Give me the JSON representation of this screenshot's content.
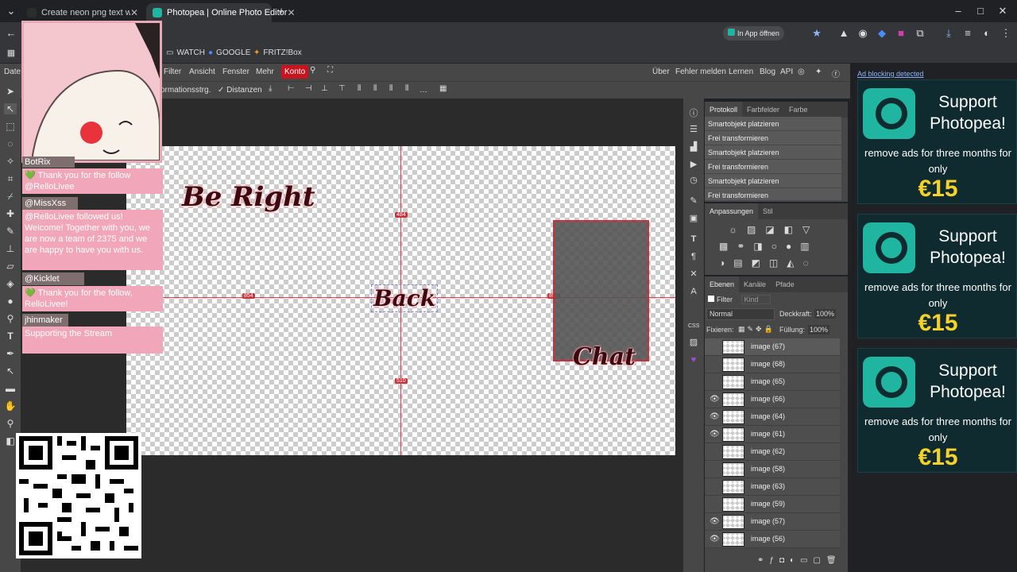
{
  "tabs": [
    {
      "title": "Create neon png text with a tra",
      "active": false
    },
    {
      "title": "Photopea | Online Photo Editor",
      "active": true
    }
  ],
  "address": {
    "open_in_app": "In App öffnen"
  },
  "bookmarks": [
    "WATCH",
    "GOOGLE",
    "FRITZ!Box"
  ],
  "menu": {
    "partial": "Date",
    "items": [
      "Filter",
      "Ansicht",
      "Fenster",
      "Mehr",
      "Konto"
    ],
    "right": [
      "Über",
      "Fehler melden",
      "Lernen",
      "Blog",
      "API"
    ]
  },
  "options": {
    "transform_label": "ormationsstrg.",
    "distances_label": "✓ Distanzen"
  },
  "history": {
    "tabs": [
      "Protokoll",
      "Farbfelder",
      "Farbe"
    ],
    "items": [
      "Smartobjekt platzieren",
      "Frei transformieren",
      "Smartobjekt platzieren",
      "Frei transformieren",
      "Smartobjekt platzieren",
      "Frei transformieren"
    ]
  },
  "adjust": {
    "tabs": [
      "Anpassungen",
      "Stil"
    ]
  },
  "layers": {
    "tabs": [
      "Ebenen",
      "Kanäle",
      "Pfade"
    ],
    "filter": "Filter",
    "kind": "Kind",
    "blend": "Normal",
    "opacity_label": "Deckkraft:",
    "opacity": "100%",
    "lock_label": "Fixieren:",
    "fill_label": "Füllung:",
    "fill": "100%",
    "items": [
      {
        "name": "image (67)",
        "visible": false
      },
      {
        "name": "image (68)",
        "visible": false
      },
      {
        "name": "image (65)",
        "visible": false
      },
      {
        "name": "image (66)",
        "visible": true
      },
      {
        "name": "image (64)",
        "visible": true
      },
      {
        "name": "image (61)",
        "visible": true
      },
      {
        "name": "image (62)",
        "visible": false
      },
      {
        "name": "image (58)",
        "visible": false
      },
      {
        "name": "image (63)",
        "visible": false
      },
      {
        "name": "image (59)",
        "visible": false
      },
      {
        "name": "image (57)",
        "visible": true
      },
      {
        "name": "image (56)",
        "visible": true
      }
    ]
  },
  "canvas": {
    "texts": [
      "Be Right",
      "Back",
      "Chat"
    ],
    "measures": [
      "484",
      "854",
      "856",
      "510"
    ]
  },
  "ads": {
    "notice": "Ad blocking detected",
    "title": "Support Photopea!",
    "body": "remove ads for three months for only",
    "price": "€15"
  },
  "stream": {
    "messages": [
      {
        "type": "text",
        "text": "BotRix"
      },
      {
        "type": "pink",
        "text": "💚 Thank you for the follow @RelloLivee"
      },
      {
        "type": "name",
        "text": "@MissXss"
      },
      {
        "type": "pink",
        "text": "@RelloLivee followed us! Welcome! Together with you, we are now a team of 2375 and we are happy to have you with us."
      },
      {
        "type": "name",
        "text": "@Kicklet"
      },
      {
        "type": "pink",
        "text": "💚 Thank you for the follow, RelloLivee!"
      },
      {
        "type": "name",
        "text": "jhinmaker"
      },
      {
        "type": "pink",
        "text": "Supporting the Stream"
      }
    ]
  }
}
